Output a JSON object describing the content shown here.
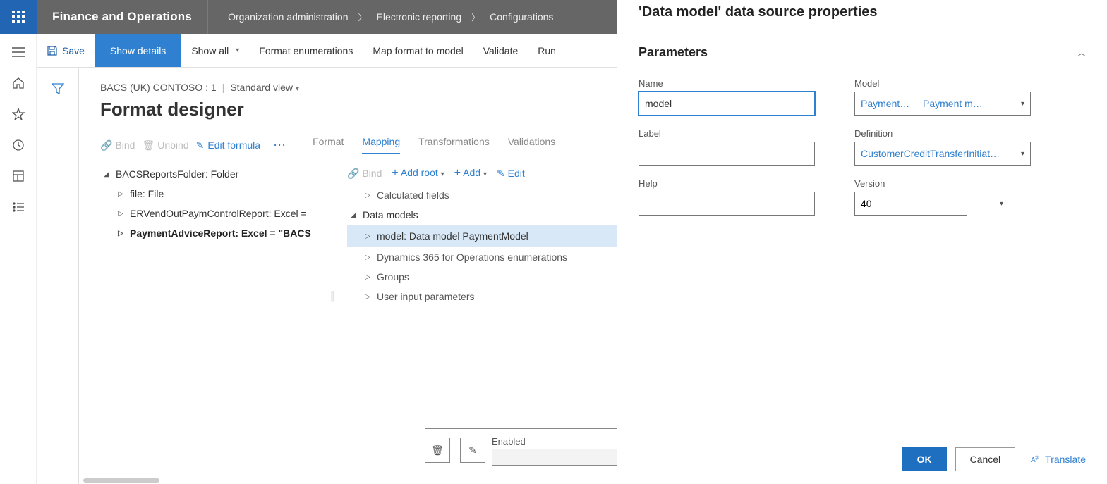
{
  "app_title": "Finance and Operations",
  "breadcrumbs": [
    "Organization administration",
    "Electronic reporting",
    "Configurations"
  ],
  "actionbar": {
    "save": "Save",
    "show_details": "Show details",
    "show_all": "Show all",
    "format_enum": "Format enumerations",
    "map_format": "Map format to model",
    "validate": "Validate",
    "run": "Run"
  },
  "config_line": {
    "name": "BACS (UK) CONTOSO : 1",
    "view": "Standard view"
  },
  "page_title": "Format designer",
  "toolbar": {
    "bind": "Bind",
    "unbind": "Unbind",
    "edit_formula": "Edit formula"
  },
  "tabs": [
    "Format",
    "Mapping",
    "Transformations",
    "Validations"
  ],
  "active_tab": 1,
  "left_tree": [
    {
      "label": "BACSReportsFolder: Folder",
      "level": 1,
      "expanded": true
    },
    {
      "label": "file: File",
      "level": 2,
      "expanded": false
    },
    {
      "label": "ERVendOutPaymControlReport: Excel =",
      "level": 2,
      "expanded": false
    },
    {
      "label": "PaymentAdviceReport: Excel = \"BACS",
      "level": 2,
      "expanded": false,
      "bold": true
    }
  ],
  "map_toolbar": {
    "bind": "Bind",
    "add_root": "Add root",
    "add": "Add",
    "edit": "Edit"
  },
  "right_tree": [
    {
      "label": "Calculated fields",
      "level": 2
    },
    {
      "label": "Data models",
      "level": 1,
      "expanded": true
    },
    {
      "label": "model: Data model PaymentModel",
      "level": 2,
      "selected": true
    },
    {
      "label": "Dynamics 365 for Operations enumerations",
      "level": 2
    },
    {
      "label": "Groups",
      "level": 2
    },
    {
      "label": "User input parameters",
      "level": 2
    }
  ],
  "footer": {
    "enabled_label": "Enabled"
  },
  "panel": {
    "title": "'Data model' data source properties",
    "section": "Parameters",
    "fields": {
      "name_label": "Name",
      "name_value": "model",
      "label_label": "Label",
      "label_value": "",
      "help_label": "Help",
      "help_value": "",
      "model_label": "Model",
      "model_a": "PaymentM…",
      "model_b": "Payment m…",
      "definition_label": "Definition",
      "definition_value": "CustomerCreditTransferInitiat…",
      "version_label": "Version",
      "version_value": "40"
    },
    "ok": "OK",
    "cancel": "Cancel",
    "translate": "Translate"
  }
}
